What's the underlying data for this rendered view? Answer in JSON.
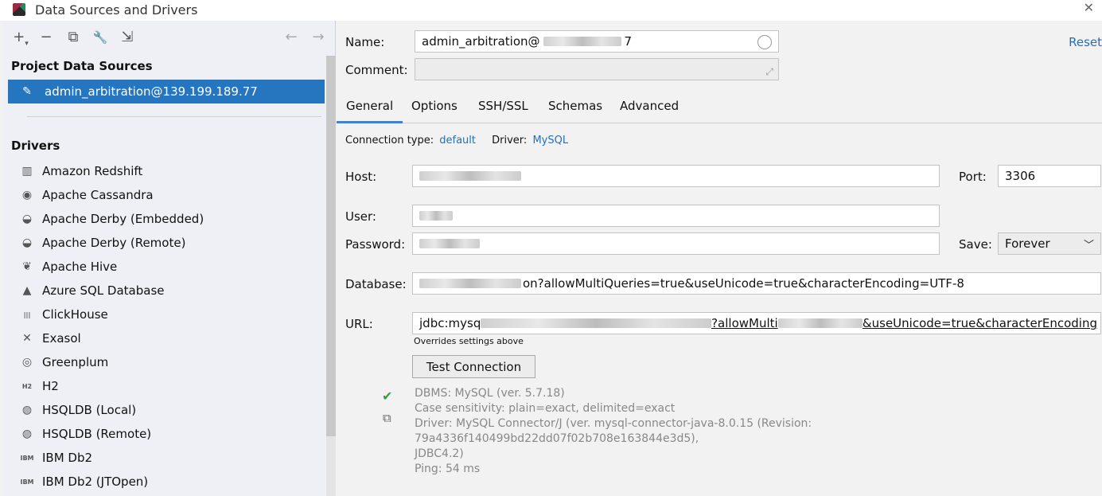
{
  "window": {
    "title": "Data Sources and Drivers",
    "close_glyph": "✕"
  },
  "toolbar": {
    "add_glyph": "+",
    "add_caret": "▾",
    "remove_glyph": "−",
    "copy_glyph": "⧉",
    "settings_glyph": "🔧",
    "import_glyph": "⇲",
    "back_glyph": "←",
    "forward_glyph": "→"
  },
  "left": {
    "project_sources_title": "Project Data Sources",
    "selected_source": "admin_arbitration@139.199.189.77",
    "drivers_title": "Drivers",
    "drivers": [
      {
        "label": "Amazon Redshift",
        "icon": "▥"
      },
      {
        "label": "Apache Cassandra",
        "icon": "◉"
      },
      {
        "label": "Apache Derby (Embedded)",
        "icon": "◒"
      },
      {
        "label": "Apache Derby (Remote)",
        "icon": "◒"
      },
      {
        "label": "Apache Hive",
        "icon": "❦"
      },
      {
        "label": "Azure SQL Database",
        "icon": "▲"
      },
      {
        "label": "ClickHouse",
        "icon": "|||"
      },
      {
        "label": "Exasol",
        "icon": "✕"
      },
      {
        "label": "Greenplum",
        "icon": "◎"
      },
      {
        "label": "H2",
        "icon": "H2"
      },
      {
        "label": "HSQLDB (Local)",
        "icon": "◍"
      },
      {
        "label": "HSQLDB (Remote)",
        "icon": "◍"
      },
      {
        "label": "IBM Db2",
        "icon": "IBM"
      },
      {
        "label": "IBM Db2 (JTOpen)",
        "icon": "IBM"
      }
    ]
  },
  "form": {
    "name_label": "Name:",
    "name_value": "admin_arbitration@",
    "name_suffix": "7",
    "comment_label": "Comment:",
    "reset_label": "Reset",
    "tabs": [
      "General",
      "Options",
      "SSH/SSL",
      "Schemas",
      "Advanced"
    ],
    "connection_type_label": "Connection type:",
    "connection_type_value": "default",
    "driver_label": "Driver:",
    "driver_value": "MySQL",
    "host_label": "Host:",
    "port_label": "Port:",
    "port_value": "3306",
    "user_label": "User:",
    "password_label": "Password:",
    "save_label": "Save:",
    "save_value": "Forever",
    "database_label": "Database:",
    "database_value": "on?allowMultiQueries=true&useUnicode=true&characterEncoding=UTF-8",
    "url_label": "URL:",
    "url_prefix": "jdbc:mysq",
    "url_mid": "?allowMulti",
    "url_suffix": "&useUnicode=true&characterEncoding",
    "overrides_note": "Overrides settings above",
    "test_button": "Test Connection"
  },
  "status": {
    "dbms": "DBMS: MySQL (ver. 5.7.18)",
    "case": "Case sensitivity: plain=exact, delimited=exact",
    "driver": "Driver: MySQL Connector/J (ver. mysql-connector-java-8.0.15 (Revision: 79a4336f140499bd22dd07f02b708e163844e3d5),",
    "driver_cont": "JDBC4.2)",
    "ping": "Ping: 54 ms",
    "check_glyph": "✔",
    "copy_glyph": "⧉"
  },
  "colors": {
    "selection": "#2675bf",
    "link": "#2470b3",
    "tab_underline": "#4083c9",
    "success": "#3a9a4b"
  }
}
